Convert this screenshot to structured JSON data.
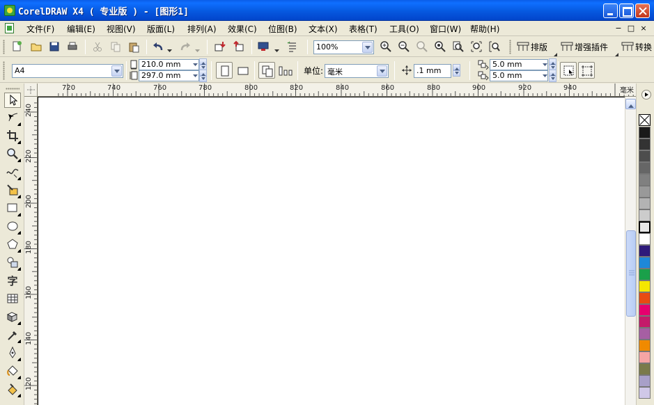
{
  "window": {
    "title": "CorelDRAW X4 ( 专业版 ) - [图形1]"
  },
  "menu": {
    "items": [
      "文件(F)",
      "编辑(E)",
      "视图(V)",
      "版面(L)",
      "排列(A)",
      "效果(C)",
      "位图(B)",
      "文本(X)",
      "表格(T)",
      "工具(O)",
      "窗口(W)",
      "帮助(H)"
    ],
    "mdi_controls": [
      "−",
      "□",
      "×"
    ]
  },
  "toolbar": {
    "zoom_value": "100%",
    "plugins": [
      {
        "label": "排版",
        "icon": "layout-icon"
      },
      {
        "label": "增强插件",
        "icon": "plugin-icon"
      },
      {
        "label": "转换",
        "icon": "convert-icon"
      }
    ]
  },
  "property_bar": {
    "paper_size": "A4",
    "width": "210.0 mm",
    "height": "297.0 mm",
    "unit_label": "单位:",
    "unit_value": "毫米",
    "nudge_value": ".1 mm",
    "duplicate_x": "5.0 mm",
    "duplicate_y": "5.0 mm"
  },
  "ruler": {
    "unit": "毫米",
    "horizontal_labels": [
      "720",
      "740",
      "760",
      "780",
      "800",
      "820",
      "840",
      "860",
      "880",
      "900",
      "920",
      "940"
    ],
    "vertical_labels": [
      "240",
      "220",
      "200",
      "180",
      "160",
      "140",
      "120"
    ]
  },
  "toolbox": {
    "tools": [
      "pick-tool-icon",
      "shape-tool-icon",
      "crop-tool-icon",
      "zoom-tool-icon",
      "freehand-tool-icon",
      "smart-fill-icon",
      "rectangle-tool-icon",
      "ellipse-tool-icon",
      "polygon-tool-icon",
      "basic-shapes-icon",
      "text-tool-icon",
      "table-tool-icon",
      "interactive-tool-icon",
      "eyedropper-tool-icon",
      "outline-tool-icon",
      "fill-tool-icon",
      "interactive-fill-icon"
    ],
    "text_tool_glyph": "字"
  },
  "palette": {
    "colors": [
      "#1a1a1a",
      "#333333",
      "#4d4d4d",
      "#666666",
      "#808080",
      "#999999",
      "#b3b3b3",
      "#cccccc",
      "#e6e6e6",
      "#ffffff",
      "#2e1a7a",
      "#1e88d8",
      "#1aa04a",
      "#f5e600",
      "#e84a12",
      "#e6006e",
      "#c41b6a",
      "#a65fa3",
      "#f08a00",
      "#f5a5a5",
      "#7a7a4a",
      "#a8a0c8",
      "#d0c8e8"
    ]
  }
}
